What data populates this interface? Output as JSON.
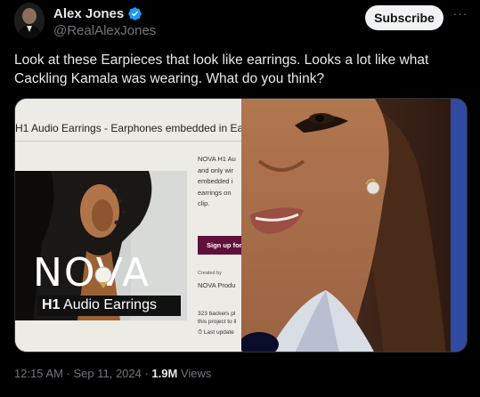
{
  "author": {
    "display_name": "Alex Jones",
    "handle": "@RealAlexJones",
    "verified_icon": "verified-badge-icon",
    "avatar": "avatar"
  },
  "actions": {
    "subscribe_label": "Subscribe",
    "more_label": "···"
  },
  "tweet": {
    "text": "Look at these Earpieces that look like earrings. Looks a lot like what Cackling Kamala was wearing. What do you think?"
  },
  "media": {
    "left": {
      "title": "H1 Audio Earrings - Earphones embedded in Ea",
      "brand": "NOVA",
      "subtitle_bold": "H1",
      "subtitle_rest": " Audio Earrings",
      "description": "NOVA H1 Au\nand only wir\nembedded i\nearrings on\nclip.",
      "signup_label": "Sign up for",
      "created_by_label": "Created by",
      "creator": "NOVA Produ",
      "backers": "323 backers pl\nthis project to li",
      "last_updated": "Last update"
    }
  },
  "meta": {
    "timestamp": "12:15 AM · Sep 11, 2024 · ",
    "views_count": "1.9M",
    "views_label": " Views"
  },
  "colors": {
    "background": "#000000",
    "text_primary": "#e7e9ea",
    "text_secondary": "#71767b",
    "verified": "#1d9bf0",
    "signup_button": "#61103b"
  }
}
